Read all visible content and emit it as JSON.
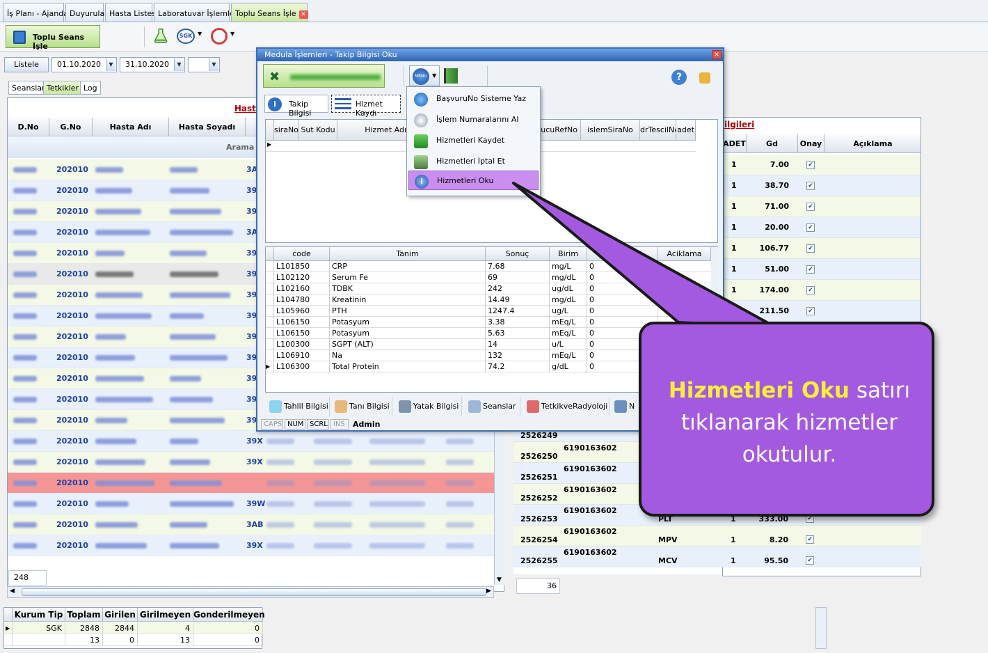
{
  "tabs": [
    "İş Planı - Ajanda",
    "Duyurular",
    "Hasta Listesi",
    "Laboratuvar İşlemleri",
    "Toplu Seans İşle"
  ],
  "toolbar": {
    "main_button": "Toplu Seans İşle",
    "icons": [
      "flask-icon",
      "sgk-icon",
      "ministry-icon"
    ]
  },
  "filter": {
    "list_button": "Listele",
    "date_start": "01.10.2020",
    "date_end": "31.10.2020",
    "extra_combo": ""
  },
  "subtabs": [
    "Seanslar",
    "Tetkikler",
    "Log"
  ],
  "main_grid": {
    "title": "Hasta Ge",
    "headers": [
      "D.No",
      "G.No",
      "Hasta Adı",
      "Hasta Soyadı"
    ],
    "search_hint": "Arama S",
    "rows": [
      {
        "gno": "202010",
        "code": "3A",
        "style": "g"
      },
      {
        "gno": "202010",
        "code": "39",
        "style": "b"
      },
      {
        "gno": "202010",
        "code": "39",
        "style": "g"
      },
      {
        "gno": "202010",
        "code": "3A",
        "style": "b"
      },
      {
        "gno": "202010",
        "code": "39",
        "style": "g"
      },
      {
        "gno": "202010",
        "code": "39",
        "style": "gr"
      },
      {
        "gno": "202010",
        "code": "39",
        "style": "g"
      },
      {
        "gno": "202010",
        "code": "39",
        "style": "b"
      },
      {
        "gno": "202010",
        "code": "39",
        "style": "g"
      },
      {
        "gno": "202010",
        "code": "39",
        "style": "b"
      },
      {
        "gno": "202010",
        "code": "39",
        "style": "g"
      },
      {
        "gno": "202010",
        "code": "39",
        "style": "b"
      },
      {
        "gno": "202010",
        "code": "39",
        "style": "g"
      },
      {
        "gno": "202010",
        "code": "39X",
        "style": "b"
      },
      {
        "gno": "202010",
        "code": "39X",
        "style": "g"
      },
      {
        "gno": "202010",
        "code": "",
        "style": "r"
      },
      {
        "gno": "202010",
        "code": "39W",
        "style": "b"
      },
      {
        "gno": "202010",
        "code": "3AB",
        "style": "g"
      },
      {
        "gno": "202010",
        "code": "39X",
        "style": "b"
      }
    ],
    "count": "248"
  },
  "popup": {
    "title": "Medula İşlemleri - Takip Bilgisi Oku",
    "tabs": [
      "Takip Bilgisi",
      "Hizmet Kaydı"
    ],
    "grid1_headers": [
      "siraNo",
      "Sut Kodu",
      "Hizmet Adı",
      "nucuRefNo",
      "islemSiraNo",
      "drTescilNo",
      "adet"
    ],
    "grid2_headers": [
      "code",
      "Tanim",
      "Sonuç",
      "Birim",
      "",
      "Aciklama"
    ],
    "grid2_rows": [
      {
        "code": "L101850",
        "tanim": "CRP",
        "sonuc": "7.68",
        "birim": "mg/L",
        "val": "0"
      },
      {
        "code": "L102120",
        "tanim": "Serum Fe",
        "sonuc": "69",
        "birim": "mg/dL",
        "val": "0"
      },
      {
        "code": "L102160",
        "tanim": "TDBK",
        "sonuc": "242",
        "birim": "ug/dL",
        "val": "0"
      },
      {
        "code": "L104780",
        "tanim": "Kreatinin",
        "sonuc": "14.49",
        "birim": "mg/dL",
        "val": "0"
      },
      {
        "code": "L105960",
        "tanim": "PTH",
        "sonuc": "1247.4",
        "birim": "ug/L",
        "val": "0"
      },
      {
        "code": "L106150",
        "tanim": "Potasyum",
        "sonuc": "3.38",
        "birim": "mEq/L",
        "val": "0"
      },
      {
        "code": "L106150",
        "tanim": "Potasyum",
        "sonuc": "5.63",
        "birim": "mEq/L",
        "val": "0"
      },
      {
        "code": "L100300",
        "tanim": "SGPT (ALT)",
        "sonuc": "14",
        "birim": "u/L",
        "val": "0"
      },
      {
        "code": "L106910",
        "tanim": "Na",
        "sonuc": "132",
        "birim": "mEq/L",
        "val": "0"
      },
      {
        "code": "L106300",
        "tanim": "Total Protein",
        "sonuc": "74.2",
        "birim": "g/dL",
        "val": "0"
      }
    ],
    "bottom_tabs": [
      "Tahlil Bilgisi",
      "Tanı Bilgisi",
      "Yatak Bilgisi",
      "Seanslar",
      "TetkikveRadyoloji",
      "N"
    ],
    "status": [
      "CAPS",
      "NUM",
      "SCRL",
      "INS",
      "Admin"
    ]
  },
  "menu": {
    "button_label": "MENU",
    "items": [
      "BaşvuruNo Sisteme Yaz",
      "İşlem Numaralarını Al",
      "Hizmetleri Kaydet",
      "Hizmetleri İptal Et",
      "Hizmetleri Oku"
    ],
    "highlighted_index": 4
  },
  "right_grid": {
    "title": "ilgileri",
    "headers": [
      "ADET",
      "Gd",
      "Onay",
      "Açıklama"
    ],
    "rows": [
      {
        "adet": "1",
        "gd": "7.00"
      },
      {
        "adet": "1",
        "gd": "38.70"
      },
      {
        "adet": "1",
        "gd": "71.00"
      },
      {
        "adet": "1",
        "gd": "20.00"
      },
      {
        "adet": "1",
        "gd": "106.77"
      },
      {
        "adet": "1",
        "gd": "51.00"
      },
      {
        "adet": "1",
        "gd": "174.00"
      },
      {
        "adet": "",
        "gd": "211.50"
      }
    ],
    "lower_rows": [
      {
        "id": "2526249",
        "ref": "6190163602",
        "test": "",
        "adet": "",
        "gd": ""
      },
      {
        "id": "2526250",
        "ref": "6190163602",
        "test": "",
        "adet": "",
        "gd": ""
      },
      {
        "id": "2526251",
        "ref": "6190163602",
        "test": "",
        "adet": "",
        "gd": ""
      },
      {
        "id": "2526252",
        "ref": "6190163602",
        "test": "",
        "adet": "",
        "gd": ""
      },
      {
        "id": "2526253",
        "ref": "6190163602",
        "test": "PLT",
        "adet": "1",
        "gd": "333.00"
      },
      {
        "id": "2526254",
        "ref": "6190163602",
        "test": "MPV",
        "adet": "1",
        "gd": "8.20"
      },
      {
        "id": "2526255",
        "ref": "6190163602",
        "test": "MCV",
        "adet": "1",
        "gd": "95.50"
      }
    ],
    "count": "36"
  },
  "callout": {
    "highlight": "Hizmetleri Oku",
    "text1": " satırı",
    "text2": "tıklanarak hizmetler",
    "text3": "okutulur."
  },
  "summary": {
    "headers": [
      "Kurum Tip",
      "Toplam",
      "Girilen",
      "Girilmeyen",
      "Gonderilmeyen"
    ],
    "rows": [
      [
        "SGK",
        "2848",
        "2844",
        "4",
        "0"
      ],
      [
        "",
        "13",
        "0",
        "13",
        "0"
      ]
    ]
  },
  "colors": {
    "accent_green": "#b7e08a",
    "highlight_purple": "#a35ae0",
    "callout_yellow": "#ffef3b",
    "row_red": "#f49696",
    "title_red": "#b00000"
  }
}
